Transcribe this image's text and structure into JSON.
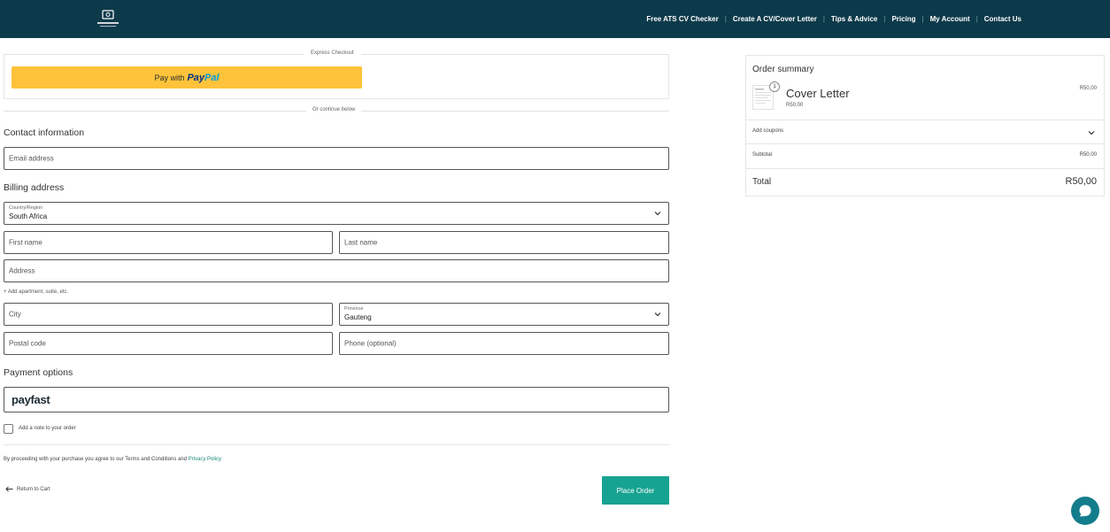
{
  "nav": {
    "items": [
      "Free ATS CV Checker",
      "Create A CV/Cover Letter",
      "Tips & Advice",
      "Pricing",
      "My Account",
      "Contact Us"
    ]
  },
  "express": {
    "label": "Express Checkout",
    "paypal_prefix": "Pay with",
    "paypal_brand_1": "Pay",
    "paypal_brand_2": "Pal",
    "continue_label": "Or continue below"
  },
  "contact": {
    "title": "Contact information",
    "email_placeholder": "Email address"
  },
  "billing": {
    "title": "Billing address",
    "country_label": "Country/Region",
    "country_value": "South Africa",
    "first_name_placeholder": "First name",
    "last_name_placeholder": "Last name",
    "address_placeholder": "Address",
    "add_apartment": "+ Add apartment, suite, etc.",
    "city_placeholder": "City",
    "province_label": "Province",
    "province_value": "Gauteng",
    "postal_placeholder": "Postal code",
    "phone_placeholder": "Phone (optional)"
  },
  "payment": {
    "title": "Payment options",
    "method": "payfast",
    "note_label": "Add a note to your order"
  },
  "terms": {
    "text": "By proceeding with your purchase you agree to our Terms and Conditions and ",
    "link": "Privacy Policy"
  },
  "actions": {
    "return_label": "Return to Cart",
    "place_order_label": "Place Order"
  },
  "summary": {
    "title": "Order summary",
    "item_name": "Cover Letter",
    "item_sub": "R50,00",
    "item_price": "R50,00",
    "item_qty": "1",
    "coupons_label": "Add coupons",
    "subtotal_label": "Subtotal",
    "subtotal_value": "R50,00",
    "total_label": "Total",
    "total_value": "R50,00"
  },
  "colors": {
    "topbar": "#0d3a4a",
    "paypal": "#fec33a",
    "accent": "#17a391",
    "chat": "#137d8c"
  }
}
